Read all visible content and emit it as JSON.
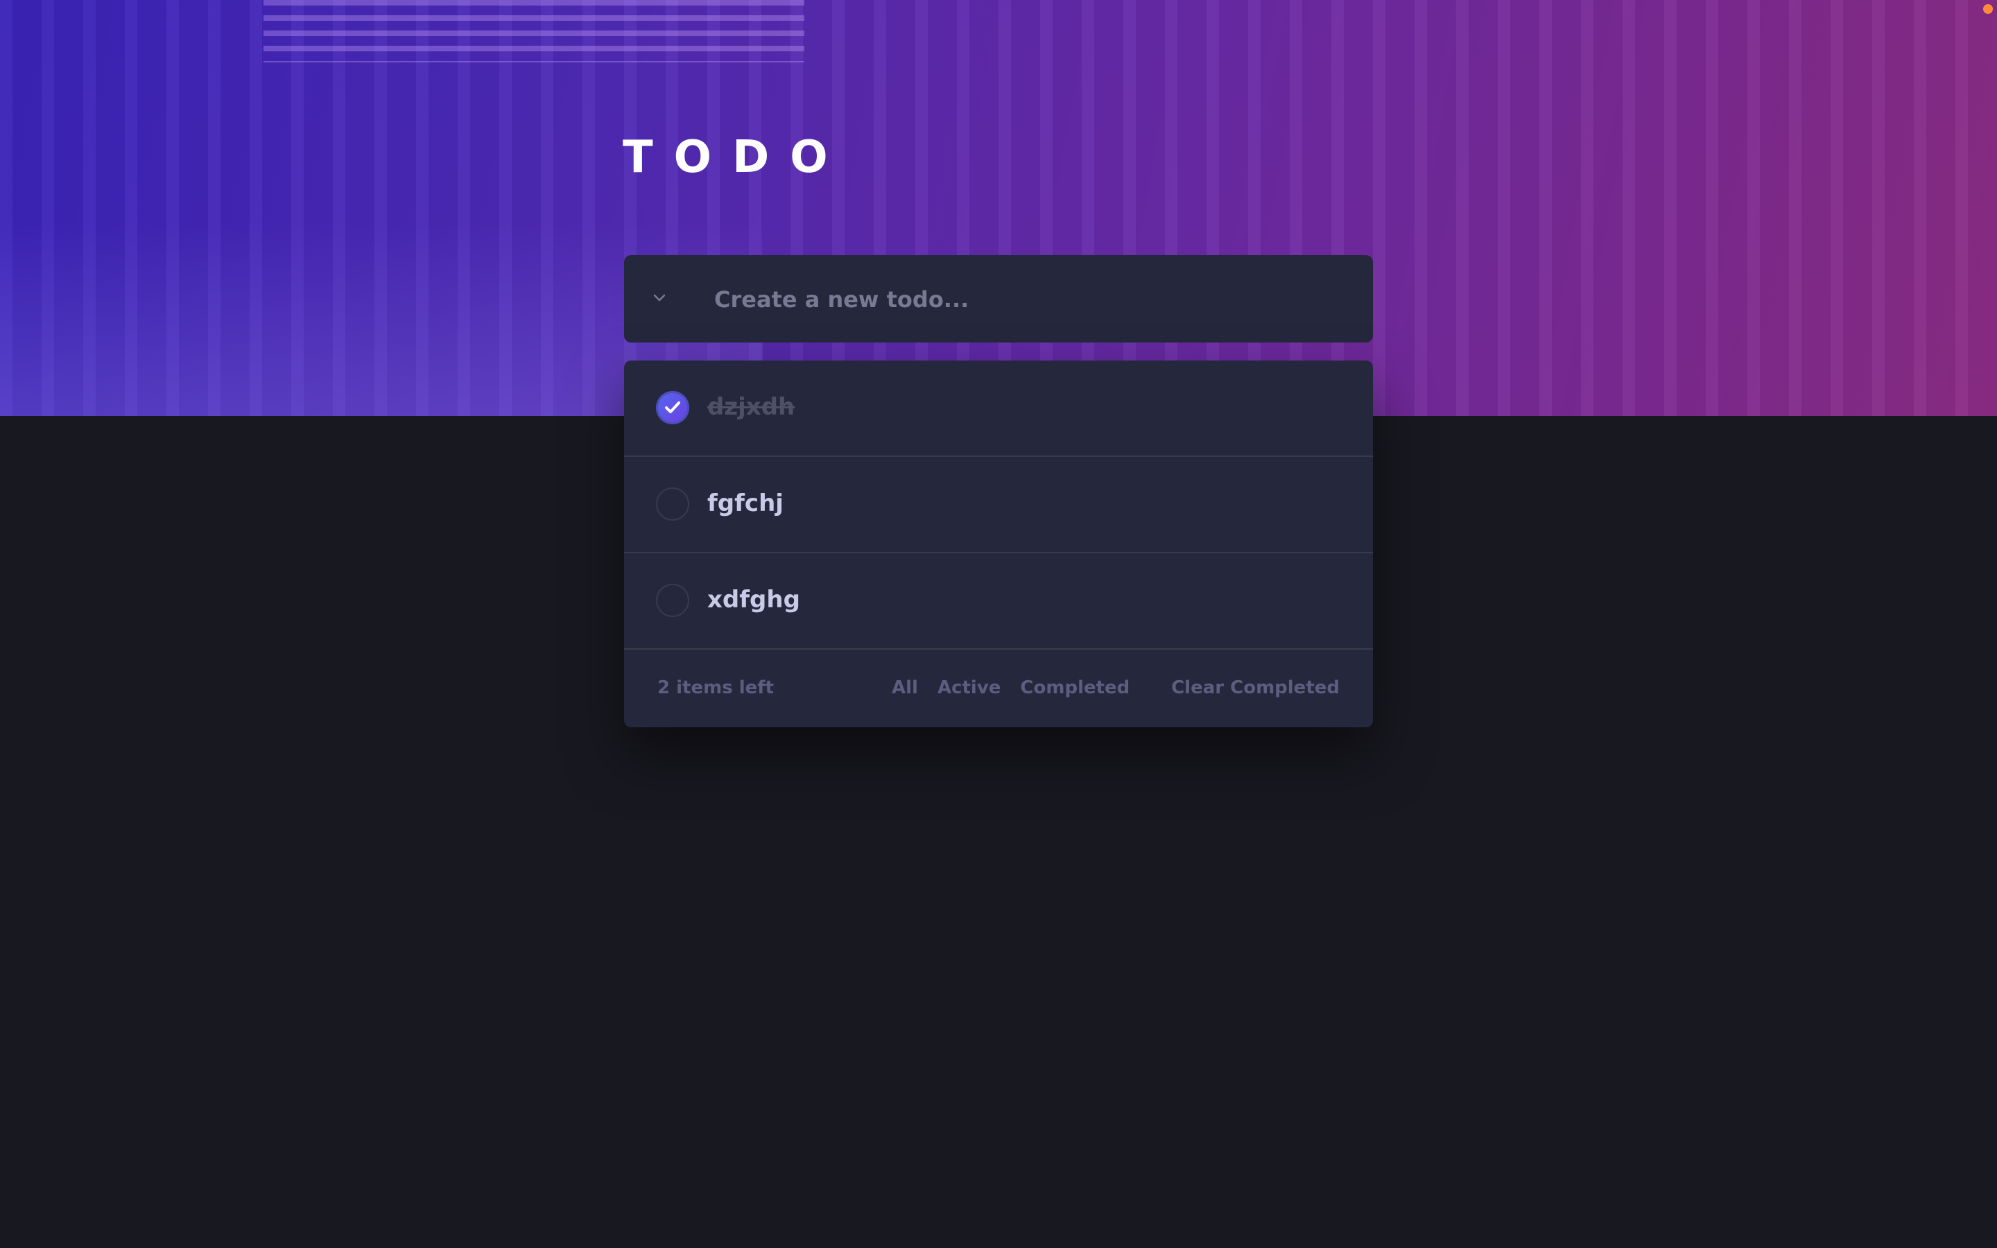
{
  "app": {
    "title": "TODO",
    "accent": "#5568f0",
    "background": "#181820",
    "panel": "#25273c"
  },
  "new_todo": {
    "placeholder": "Create a new todo...",
    "value": "",
    "toggle_icon": "chevron-down-icon"
  },
  "todos": [
    {
      "text": "dzjxdh",
      "completed": true
    },
    {
      "text": "fgfchj",
      "completed": false
    },
    {
      "text": "xdfghg",
      "completed": false
    }
  ],
  "footer": {
    "items_left": "2 items left",
    "filters": [
      "All",
      "Active",
      "Completed"
    ],
    "clear_label": "Clear Completed"
  }
}
